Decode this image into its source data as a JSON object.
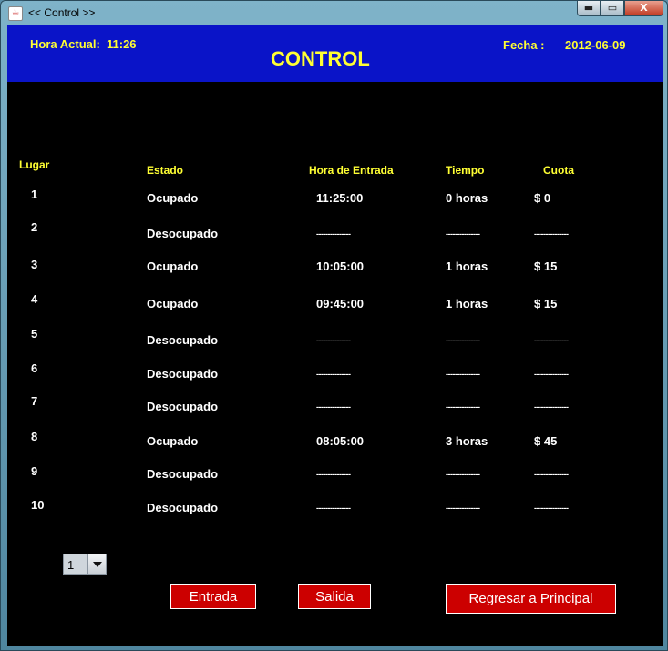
{
  "window": {
    "title": "<< Control >>",
    "min_label": "▬",
    "max_label": "▭",
    "close_label": "X"
  },
  "header": {
    "time_label": "Hora Actual:",
    "time_value": "11:26",
    "title": "CONTROL",
    "date_label": "Fecha :",
    "date_value": "2012-06-09"
  },
  "table": {
    "headers": {
      "lugar": "Lugar",
      "estado": "Estado",
      "hora": "Hora de Entrada",
      "tiempo": "Tiempo",
      "cuota": "Cuota"
    },
    "rows": [
      {
        "lugar": "1",
        "estado": "Ocupado",
        "hora": "11:25:00",
        "tiempo": "0 horas",
        "cuota": "$ 0"
      },
      {
        "lugar": "2",
        "estado": "Desocupado",
        "hora": "---------------",
        "tiempo": "---------------",
        "cuota": "---------------"
      },
      {
        "lugar": "3",
        "estado": "Ocupado",
        "hora": "10:05:00",
        "tiempo": "1 horas",
        "cuota": "$ 15"
      },
      {
        "lugar": "4",
        "estado": "Ocupado",
        "hora": "09:45:00",
        "tiempo": "1 horas",
        "cuota": "$ 15"
      },
      {
        "lugar": "5",
        "estado": "Desocupado",
        "hora": "---------------",
        "tiempo": "---------------",
        "cuota": "---------------"
      },
      {
        "lugar": "6",
        "estado": "Desocupado",
        "hora": "---------------",
        "tiempo": "---------------",
        "cuota": "---------------"
      },
      {
        "lugar": "7",
        "estado": "Desocupado",
        "hora": "---------------",
        "tiempo": "---------------",
        "cuota": "---------------"
      },
      {
        "lugar": "8",
        "estado": "Ocupado",
        "hora": "08:05:00",
        "tiempo": "3 horas",
        "cuota": "$ 45"
      },
      {
        "lugar": "9",
        "estado": "Desocupado",
        "hora": "---------------",
        "tiempo": "---------------",
        "cuota": "---------------"
      },
      {
        "lugar": "10",
        "estado": "Desocupado",
        "hora": "---------------",
        "tiempo": "---------------",
        "cuota": "---------------"
      }
    ]
  },
  "combo": {
    "selected": "1"
  },
  "buttons": {
    "entrada": "Entrada",
    "salida": "Salida",
    "regresar": "Regresar a Principal"
  }
}
